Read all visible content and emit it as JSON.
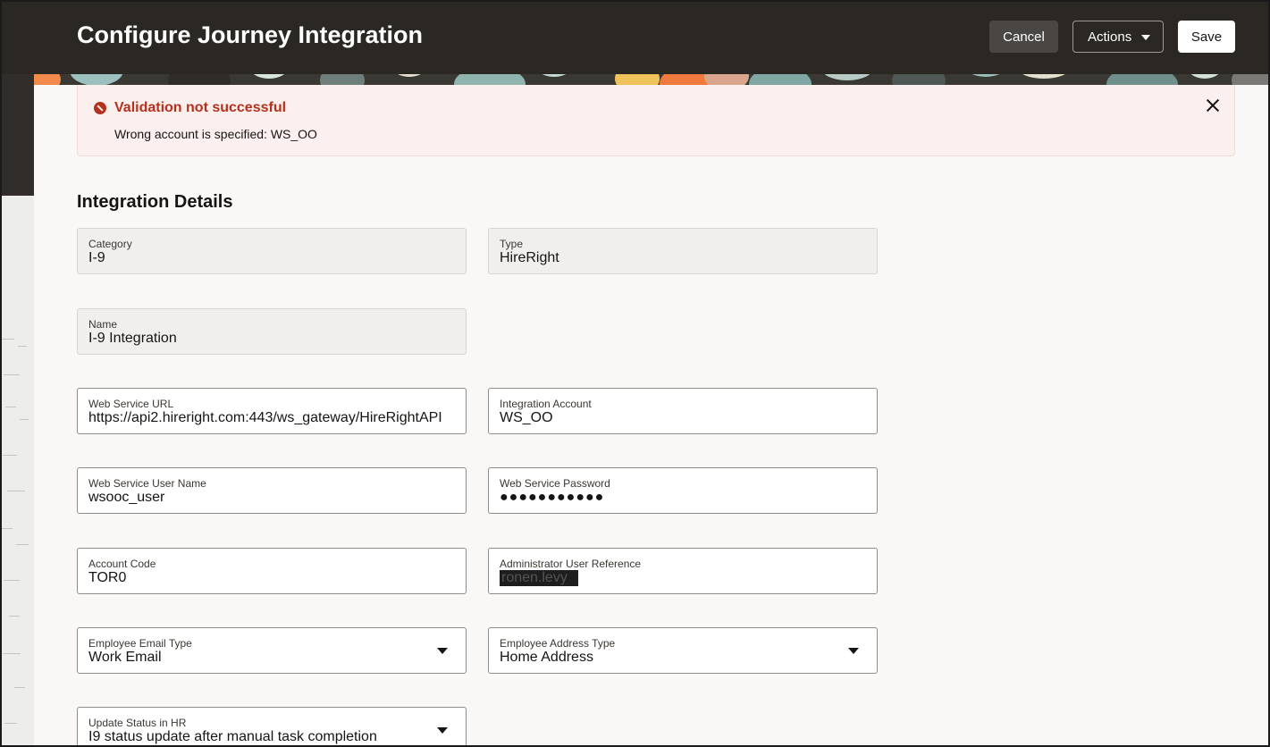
{
  "header": {
    "title": "Configure Journey Integration",
    "cancel_label": "Cancel",
    "actions_label": "Actions",
    "save_label": "Save"
  },
  "alert": {
    "title": "Validation not successful",
    "message": "Wrong account is specified: WS_OO"
  },
  "section": {
    "title": "Integration Details"
  },
  "fields": {
    "category": {
      "label": "Category",
      "value": "I-9"
    },
    "type": {
      "label": "Type",
      "value": "HireRight"
    },
    "name": {
      "label": "Name",
      "value": "I-9 Integration"
    },
    "web_service_url": {
      "label": "Web Service URL",
      "value": "https://api2.hireright.com:443/ws_gateway/HireRightAPI"
    },
    "integration_account": {
      "label": "Integration Account",
      "value": "WS_OO"
    },
    "web_service_user_name": {
      "label": "Web Service User Name",
      "value": "wsooc_user"
    },
    "web_service_password": {
      "label": "Web Service Password",
      "value": "●●●●●●●●●●●"
    },
    "account_code": {
      "label": "Account Code",
      "value": "TOR0"
    },
    "administrator_user_reference": {
      "label": "Administrator User Reference",
      "value": "ronen.levy"
    },
    "employee_email_type": {
      "label": "Employee Email Type",
      "value": "Work Email"
    },
    "employee_address_type": {
      "label": "Employee Address Type",
      "value": "Home Address"
    },
    "update_status_in_hr": {
      "label": "Update Status in HR",
      "value": "I9 status update after manual task completion"
    }
  },
  "icons": {
    "alert": "error-circle-icon",
    "close": "close-icon",
    "dropdown": "chevron-down-icon"
  },
  "colors": {
    "header_bg": "#2b2824",
    "error": "#b3321f",
    "alert_bg": "#fcf0ee",
    "page_bg": "#f9f8f6"
  }
}
